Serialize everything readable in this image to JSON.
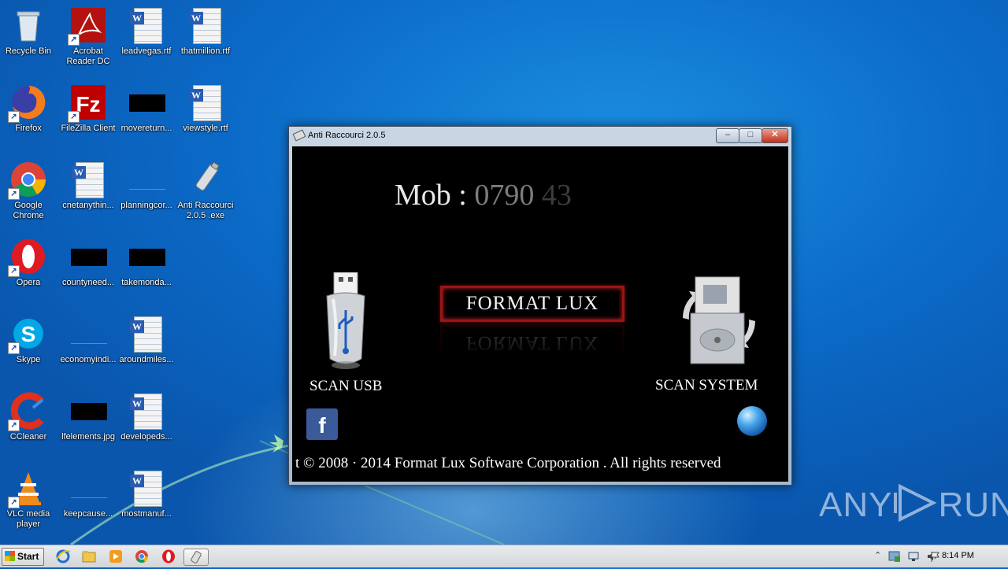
{
  "desktop": {
    "icons": [
      {
        "label": "Recycle Bin"
      },
      {
        "label": "Acrobat Reader DC"
      },
      {
        "label": "leadvegas.rtf"
      },
      {
        "label": "thatmillion.rtf"
      },
      {
        "label": "Firefox"
      },
      {
        "label": "FileZilla Client"
      },
      {
        "label": "movereturn..."
      },
      {
        "label": "viewstyle.rtf"
      },
      {
        "label": "Google Chrome"
      },
      {
        "label": "cnetanythin..."
      },
      {
        "label": "planningcor..."
      },
      {
        "label": "Anti Raccourci 2.0.5 .exe"
      },
      {
        "label": "Opera"
      },
      {
        "label": "countyneed..."
      },
      {
        "label": "takemonda..."
      },
      {
        "label": "Skype"
      },
      {
        "label": "economyindi..."
      },
      {
        "label": "aroundmiles..."
      },
      {
        "label": "CCleaner"
      },
      {
        "label": "lfelements.jpg"
      },
      {
        "label": "developeds..."
      },
      {
        "label": "VLC media player"
      },
      {
        "label": "keepcause..."
      },
      {
        "label": "mostmanuf..."
      }
    ]
  },
  "window": {
    "title": "Anti Raccourci 2.0.5",
    "controls": {
      "minimize": "–",
      "maximize": "□",
      "close": "✕"
    },
    "mob_label": "Mob : ",
    "mob_number": "0790",
    "mob_number_faded": "43",
    "brand_button": "FORMAT LUX",
    "scan_usb": "SCAN USB",
    "scan_system": "SCAN SYSTEM",
    "facebook_glyph": "f",
    "copyright": "t © 2008 · 2014  Format Lux  Software Corporation . All rights reserved"
  },
  "watermark": {
    "text_left": "ANY",
    "text_right": "RUN"
  },
  "taskbar": {
    "start_label": "Start",
    "clock": "8:14 PM",
    "tray_chevron": "⌃"
  },
  "colors": {
    "accent_red": "#9c1414",
    "desktop_blue": "#0b6ac7"
  }
}
